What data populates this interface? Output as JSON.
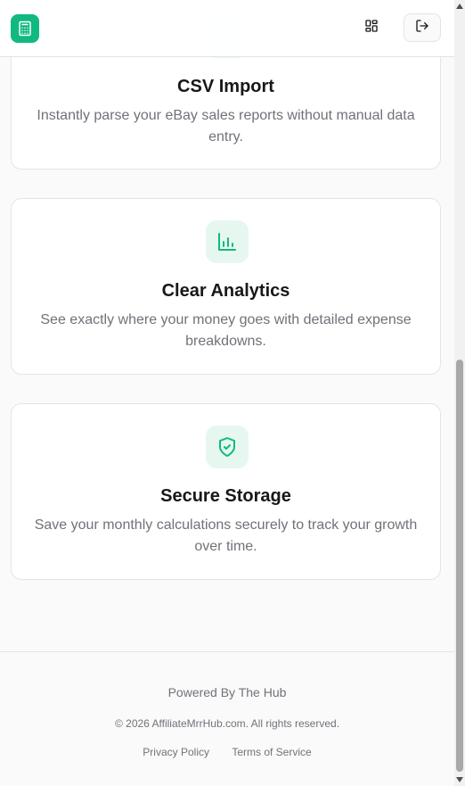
{
  "header": {
    "logo_icon": "calculator-icon",
    "grid_icon": "layout-grid-icon",
    "logout_icon": "log-out-icon"
  },
  "features": [
    {
      "icon": "upload-icon",
      "title": "CSV Import",
      "description": "Instantly parse your eBay sales reports without manual data entry."
    },
    {
      "icon": "bar-chart-icon",
      "title": "Clear Analytics",
      "description": "See exactly where your money goes with detailed expense breakdowns."
    },
    {
      "icon": "shield-check-icon",
      "title": "Secure Storage",
      "description": "Save your monthly calculations securely to track your growth over time."
    }
  ],
  "footer": {
    "powered_by": "Powered By The Hub",
    "copyright": "© 2026 AffiliateMrrHub.com. All rights reserved.",
    "links": [
      "Privacy Policy",
      "Terms of Service"
    ]
  },
  "colors": {
    "accent": "#10b981",
    "icon_bg": "#e6f7f0",
    "text_muted": "#71717a",
    "border": "#e4e4e7"
  }
}
